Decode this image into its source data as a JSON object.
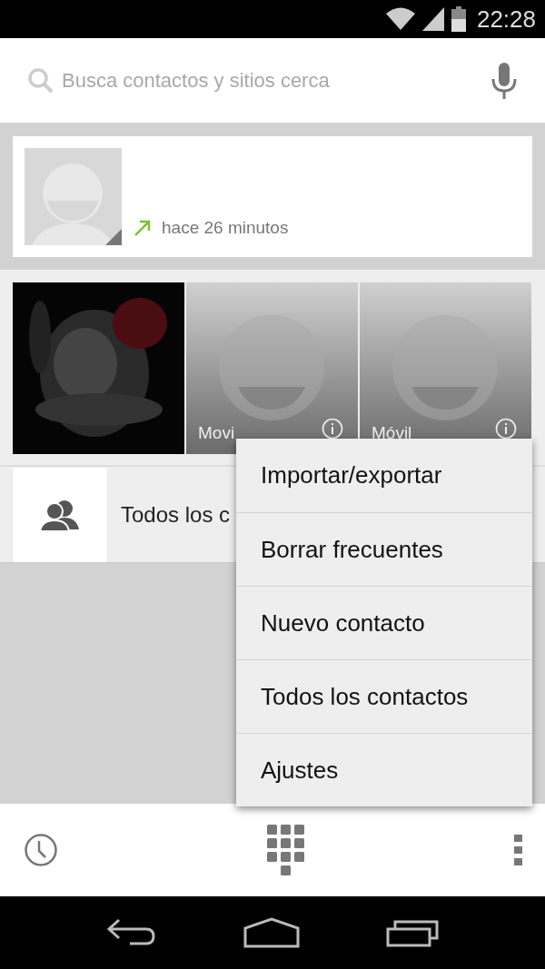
{
  "status_bar": {
    "time": "22:28"
  },
  "search": {
    "placeholder": "Busca contactos y sitios cerca"
  },
  "recent_call": {
    "time_ago": "hace 26 minutos",
    "outgoing": true
  },
  "favorites": [
    {
      "kind": "picture"
    },
    {
      "kind": "avatar",
      "label": "Movi"
    },
    {
      "kind": "avatar",
      "label": "Móvil"
    }
  ],
  "all_contacts_row": {
    "label": "Todos los c"
  },
  "menu": {
    "items": [
      "Importar/exportar",
      "Borrar frecuentes",
      "Nuevo contacto",
      "Todos los contactos",
      "Ajustes"
    ]
  }
}
